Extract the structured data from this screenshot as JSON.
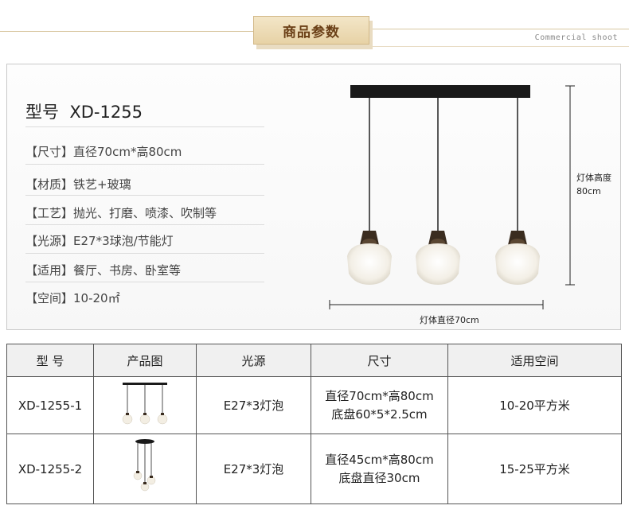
{
  "header": {
    "title": "商品参数",
    "subtitle": "Commercial shoot"
  },
  "product": {
    "model_label": "型号",
    "model": "XD-1255",
    "specs": [
      {
        "text": "【尺寸】直径70cm*高80cm"
      },
      {
        "text": "【材质】铁艺+玻璃"
      },
      {
        "text": "【工艺】抛光、打磨、喷漆、吹制等"
      },
      {
        "text": "【光源】E27*3球泡/节能灯"
      },
      {
        "text": "【适用】餐厅、书房、卧室等"
      },
      {
        "text": "【空间】10-20㎡"
      }
    ]
  },
  "dimensions": {
    "height_label_line1": "灯体高度",
    "height_label_line2": "80cm",
    "width_label": "灯体直径70cm"
  },
  "table": {
    "headers": [
      "型 号",
      "产品图",
      "光源",
      "尺寸",
      "适用空间"
    ],
    "rows": [
      {
        "model": "XD-1255-1",
        "light": "E27*3灯泡",
        "size_line1": "直径70cm*高80cm",
        "size_line2": "底盘60*5*2.5cm",
        "space": "10-20平方米"
      },
      {
        "model": "XD-1255-2",
        "light": "E27*3灯泡",
        "size_line1": "直径45cm*高80cm",
        "size_line2": "底盘直径30cm",
        "space": "15-25平方米"
      }
    ]
  },
  "colors": {
    "accent": "#e7d2a6",
    "accent_text": "#6a3f16",
    "border": "#555555"
  }
}
